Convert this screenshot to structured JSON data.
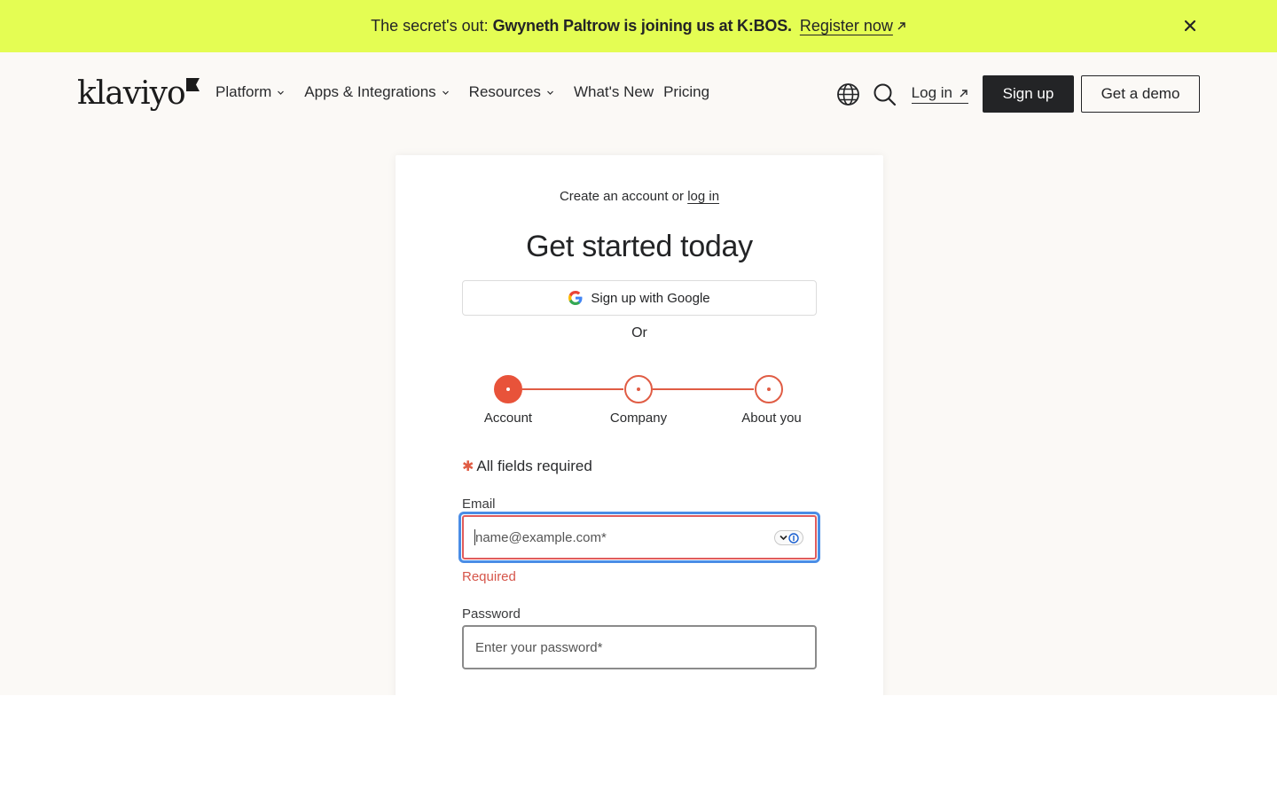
{
  "banner": {
    "lead": "The secret's out:",
    "bold": "Gwyneth Paltrow is joining us at K:BOS.",
    "link": "Register now",
    "background": "#e4fd53"
  },
  "nav": {
    "logo": "klaviyo",
    "links": [
      {
        "label": "Platform",
        "dropdown": true
      },
      {
        "label": "Apps & Integrations",
        "dropdown": true
      },
      {
        "label": "Resources",
        "dropdown": true
      },
      {
        "label": "What's New",
        "dropdown": false
      },
      {
        "label": "Pricing",
        "dropdown": false
      }
    ],
    "login": "Log in",
    "signup": "Sign up",
    "demo": "Get a demo"
  },
  "form": {
    "create_prefix": "Create an account or",
    "create_link": "log in",
    "title": "Get started today",
    "google": "Sign up with Google",
    "or": "Or",
    "steps": [
      "Account",
      "Company",
      "About you"
    ],
    "active_step": 0,
    "required_note": "All fields required",
    "email_label": "Email",
    "email_placeholder": "name@example.com*",
    "email_error": "Required",
    "password_label": "Password",
    "password_placeholder": "Enter your password*"
  },
  "colors": {
    "accent": "#e8533a",
    "error": "#d6554a",
    "focus": "#4a8de6",
    "dark": "#232426"
  }
}
